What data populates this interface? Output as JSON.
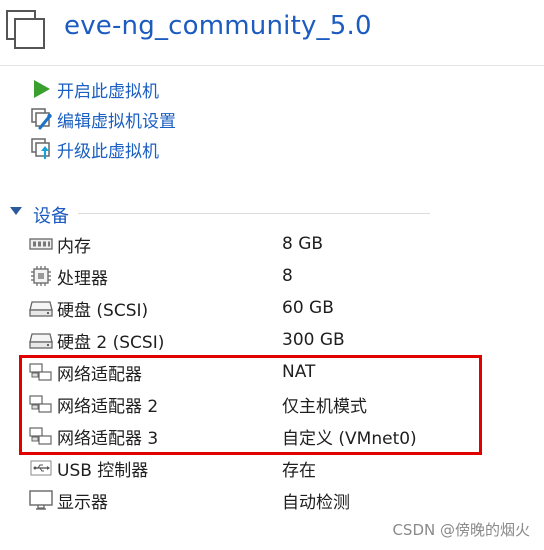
{
  "header": {
    "title": "eve-ng_community_5.0",
    "icon": "vm-window-icon"
  },
  "actions": [
    {
      "label": "开启此虚拟机",
      "icon": "play-icon",
      "color": "#3aa02d"
    },
    {
      "label": "编辑虚拟机设置",
      "icon": "edit-settings-icon"
    },
    {
      "label": "升级此虚拟机",
      "icon": "upgrade-icon"
    }
  ],
  "devices_section": {
    "label": "设备",
    "expanded": true
  },
  "devices": [
    {
      "name": "内存",
      "value": "8 GB",
      "icon": "memory-icon"
    },
    {
      "name": "处理器",
      "value": "8",
      "icon": "cpu-icon"
    },
    {
      "name": "硬盘 (SCSI)",
      "value": "60 GB",
      "icon": "hard-disk-icon"
    },
    {
      "name": "硬盘 2 (SCSI)",
      "value": "300 GB",
      "icon": "hard-disk-icon"
    },
    {
      "name": "网络适配器",
      "value": "NAT",
      "icon": "network-adapter-icon"
    },
    {
      "name": "网络适配器 2",
      "value": "仅主机模式",
      "icon": "network-adapter-icon"
    },
    {
      "name": "网络适配器 3",
      "value": "自定义 (VMnet0)",
      "icon": "network-adapter-icon"
    },
    {
      "name": "USB 控制器",
      "value": "存在",
      "icon": "usb-icon"
    },
    {
      "name": "显示器",
      "value": "自动检测",
      "icon": "monitor-icon"
    }
  ],
  "highlight_color": "#e00000",
  "watermark": "CSDN @傍晚的烟火"
}
